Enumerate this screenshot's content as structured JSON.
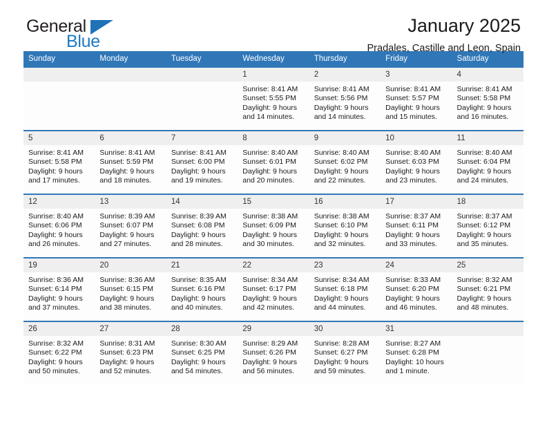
{
  "brand": {
    "name_top": "General",
    "name_bottom": "Blue",
    "color_dark": "#231f20",
    "color_blue": "#1f7ac4"
  },
  "header": {
    "title": "January 2025",
    "subtitle": "Pradales, Castille and Leon, Spain"
  },
  "theme": {
    "header_blue": "#3077b8",
    "daynum_bg": "#efefef",
    "cell_bg": "#fdfdfd"
  },
  "calendar": {
    "weekday_headers": [
      "Sunday",
      "Monday",
      "Tuesday",
      "Wednesday",
      "Thursday",
      "Friday",
      "Saturday"
    ],
    "weeks": [
      [
        {
          "day": "",
          "sunrise": "",
          "sunset": "",
          "daylight_line1": "",
          "daylight_line2": ""
        },
        {
          "day": "",
          "sunrise": "",
          "sunset": "",
          "daylight_line1": "",
          "daylight_line2": ""
        },
        {
          "day": "",
          "sunrise": "",
          "sunset": "",
          "daylight_line1": "",
          "daylight_line2": ""
        },
        {
          "day": "1",
          "sunrise": "Sunrise: 8:41 AM",
          "sunset": "Sunset: 5:55 PM",
          "daylight_line1": "Daylight: 9 hours",
          "daylight_line2": "and 14 minutes."
        },
        {
          "day": "2",
          "sunrise": "Sunrise: 8:41 AM",
          "sunset": "Sunset: 5:56 PM",
          "daylight_line1": "Daylight: 9 hours",
          "daylight_line2": "and 14 minutes."
        },
        {
          "day": "3",
          "sunrise": "Sunrise: 8:41 AM",
          "sunset": "Sunset: 5:57 PM",
          "daylight_line1": "Daylight: 9 hours",
          "daylight_line2": "and 15 minutes."
        },
        {
          "day": "4",
          "sunrise": "Sunrise: 8:41 AM",
          "sunset": "Sunset: 5:58 PM",
          "daylight_line1": "Daylight: 9 hours",
          "daylight_line2": "and 16 minutes."
        }
      ],
      [
        {
          "day": "5",
          "sunrise": "Sunrise: 8:41 AM",
          "sunset": "Sunset: 5:58 PM",
          "daylight_line1": "Daylight: 9 hours",
          "daylight_line2": "and 17 minutes."
        },
        {
          "day": "6",
          "sunrise": "Sunrise: 8:41 AM",
          "sunset": "Sunset: 5:59 PM",
          "daylight_line1": "Daylight: 9 hours",
          "daylight_line2": "and 18 minutes."
        },
        {
          "day": "7",
          "sunrise": "Sunrise: 8:41 AM",
          "sunset": "Sunset: 6:00 PM",
          "daylight_line1": "Daylight: 9 hours",
          "daylight_line2": "and 19 minutes."
        },
        {
          "day": "8",
          "sunrise": "Sunrise: 8:40 AM",
          "sunset": "Sunset: 6:01 PM",
          "daylight_line1": "Daylight: 9 hours",
          "daylight_line2": "and 20 minutes."
        },
        {
          "day": "9",
          "sunrise": "Sunrise: 8:40 AM",
          "sunset": "Sunset: 6:02 PM",
          "daylight_line1": "Daylight: 9 hours",
          "daylight_line2": "and 22 minutes."
        },
        {
          "day": "10",
          "sunrise": "Sunrise: 8:40 AM",
          "sunset": "Sunset: 6:03 PM",
          "daylight_line1": "Daylight: 9 hours",
          "daylight_line2": "and 23 minutes."
        },
        {
          "day": "11",
          "sunrise": "Sunrise: 8:40 AM",
          "sunset": "Sunset: 6:04 PM",
          "daylight_line1": "Daylight: 9 hours",
          "daylight_line2": "and 24 minutes."
        }
      ],
      [
        {
          "day": "12",
          "sunrise": "Sunrise: 8:40 AM",
          "sunset": "Sunset: 6:06 PM",
          "daylight_line1": "Daylight: 9 hours",
          "daylight_line2": "and 26 minutes."
        },
        {
          "day": "13",
          "sunrise": "Sunrise: 8:39 AM",
          "sunset": "Sunset: 6:07 PM",
          "daylight_line1": "Daylight: 9 hours",
          "daylight_line2": "and 27 minutes."
        },
        {
          "day": "14",
          "sunrise": "Sunrise: 8:39 AM",
          "sunset": "Sunset: 6:08 PM",
          "daylight_line1": "Daylight: 9 hours",
          "daylight_line2": "and 28 minutes."
        },
        {
          "day": "15",
          "sunrise": "Sunrise: 8:38 AM",
          "sunset": "Sunset: 6:09 PM",
          "daylight_line1": "Daylight: 9 hours",
          "daylight_line2": "and 30 minutes."
        },
        {
          "day": "16",
          "sunrise": "Sunrise: 8:38 AM",
          "sunset": "Sunset: 6:10 PM",
          "daylight_line1": "Daylight: 9 hours",
          "daylight_line2": "and 32 minutes."
        },
        {
          "day": "17",
          "sunrise": "Sunrise: 8:37 AM",
          "sunset": "Sunset: 6:11 PM",
          "daylight_line1": "Daylight: 9 hours",
          "daylight_line2": "and 33 minutes."
        },
        {
          "day": "18",
          "sunrise": "Sunrise: 8:37 AM",
          "sunset": "Sunset: 6:12 PM",
          "daylight_line1": "Daylight: 9 hours",
          "daylight_line2": "and 35 minutes."
        }
      ],
      [
        {
          "day": "19",
          "sunrise": "Sunrise: 8:36 AM",
          "sunset": "Sunset: 6:14 PM",
          "daylight_line1": "Daylight: 9 hours",
          "daylight_line2": "and 37 minutes."
        },
        {
          "day": "20",
          "sunrise": "Sunrise: 8:36 AM",
          "sunset": "Sunset: 6:15 PM",
          "daylight_line1": "Daylight: 9 hours",
          "daylight_line2": "and 38 minutes."
        },
        {
          "day": "21",
          "sunrise": "Sunrise: 8:35 AM",
          "sunset": "Sunset: 6:16 PM",
          "daylight_line1": "Daylight: 9 hours",
          "daylight_line2": "and 40 minutes."
        },
        {
          "day": "22",
          "sunrise": "Sunrise: 8:34 AM",
          "sunset": "Sunset: 6:17 PM",
          "daylight_line1": "Daylight: 9 hours",
          "daylight_line2": "and 42 minutes."
        },
        {
          "day": "23",
          "sunrise": "Sunrise: 8:34 AM",
          "sunset": "Sunset: 6:18 PM",
          "daylight_line1": "Daylight: 9 hours",
          "daylight_line2": "and 44 minutes."
        },
        {
          "day": "24",
          "sunrise": "Sunrise: 8:33 AM",
          "sunset": "Sunset: 6:20 PM",
          "daylight_line1": "Daylight: 9 hours",
          "daylight_line2": "and 46 minutes."
        },
        {
          "day": "25",
          "sunrise": "Sunrise: 8:32 AM",
          "sunset": "Sunset: 6:21 PM",
          "daylight_line1": "Daylight: 9 hours",
          "daylight_line2": "and 48 minutes."
        }
      ],
      [
        {
          "day": "26",
          "sunrise": "Sunrise: 8:32 AM",
          "sunset": "Sunset: 6:22 PM",
          "daylight_line1": "Daylight: 9 hours",
          "daylight_line2": "and 50 minutes."
        },
        {
          "day": "27",
          "sunrise": "Sunrise: 8:31 AM",
          "sunset": "Sunset: 6:23 PM",
          "daylight_line1": "Daylight: 9 hours",
          "daylight_line2": "and 52 minutes."
        },
        {
          "day": "28",
          "sunrise": "Sunrise: 8:30 AM",
          "sunset": "Sunset: 6:25 PM",
          "daylight_line1": "Daylight: 9 hours",
          "daylight_line2": "and 54 minutes."
        },
        {
          "day": "29",
          "sunrise": "Sunrise: 8:29 AM",
          "sunset": "Sunset: 6:26 PM",
          "daylight_line1": "Daylight: 9 hours",
          "daylight_line2": "and 56 minutes."
        },
        {
          "day": "30",
          "sunrise": "Sunrise: 8:28 AM",
          "sunset": "Sunset: 6:27 PM",
          "daylight_line1": "Daylight: 9 hours",
          "daylight_line2": "and 59 minutes."
        },
        {
          "day": "31",
          "sunrise": "Sunrise: 8:27 AM",
          "sunset": "Sunset: 6:28 PM",
          "daylight_line1": "Daylight: 10 hours",
          "daylight_line2": "and 1 minute."
        },
        {
          "day": "",
          "sunrise": "",
          "sunset": "",
          "daylight_line1": "",
          "daylight_line2": ""
        }
      ]
    ]
  }
}
